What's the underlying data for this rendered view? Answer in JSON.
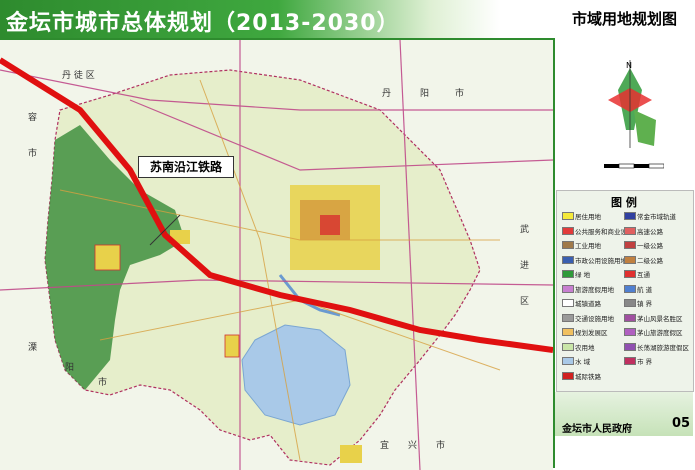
{
  "header": {
    "title": "金坛市城市总体规划（2013-2030）",
    "subtitle": "市域用地规划图"
  },
  "map": {
    "callout_label": "苏南沿江铁路",
    "place_labels": [
      {
        "text": "丹 徒 区"
      },
      {
        "text": "丹"
      },
      {
        "text": "阳"
      },
      {
        "text": "市"
      },
      {
        "text": "容"
      },
      {
        "text": "市"
      },
      {
        "text": "武"
      },
      {
        "text": "进"
      },
      {
        "text": "区"
      },
      {
        "text": "溧"
      },
      {
        "text": "阳"
      },
      {
        "text": "市"
      },
      {
        "text": "宜"
      },
      {
        "text": "兴"
      },
      {
        "text": "市"
      }
    ]
  },
  "sidepanel": {
    "compass_letter": "N",
    "legend_title": "图 例",
    "legend_left": [
      {
        "label": "居住用地",
        "color": "#f5e93a"
      },
      {
        "label": "公共服务和商业设施",
        "color": "#e23b3b"
      },
      {
        "label": "工业用地",
        "color": "#a07a4a"
      },
      {
        "label": "市政公用设施用地",
        "color": "#3a5fb0"
      },
      {
        "label": "绿 地",
        "color": "#2f9a3a"
      },
      {
        "label": "旅游度假用地",
        "color": "#c77fd0"
      },
      {
        "label": "城镇道路",
        "color": "#ffffff"
      },
      {
        "label": "交通设施用地",
        "color": "#9a9a9a"
      },
      {
        "label": "规划发展区",
        "color": "#f0c060"
      },
      {
        "label": "农用地",
        "color": "#c9e6a8"
      },
      {
        "label": "水 域",
        "color": "#a9c9e8"
      },
      {
        "label": "城际铁路",
        "color": "#d02020"
      }
    ],
    "legend_right": [
      {
        "label": "常金市域轨道",
        "color": "#3040a0"
      },
      {
        "label": "高速公路",
        "color": "#e06060"
      },
      {
        "label": "一级公路",
        "color": "#c04040"
      },
      {
        "label": "二级公路",
        "color": "#c08040"
      },
      {
        "label": "互通",
        "color": "#e03030"
      },
      {
        "label": "航 道",
        "color": "#5080d0"
      },
      {
        "label": "镇 界",
        "color": "#888888"
      },
      {
        "label": "茅山风景名胜区",
        "color": "#a050a0"
      },
      {
        "label": "茅山旅游度假区",
        "color": "#b060c0"
      },
      {
        "label": "长荡湖旅游度假区",
        "color": "#9050b0"
      },
      {
        "label": "市 界",
        "color": "#c03060"
      }
    ],
    "footer_org": "金坛市人民政府",
    "page_number": "05"
  }
}
